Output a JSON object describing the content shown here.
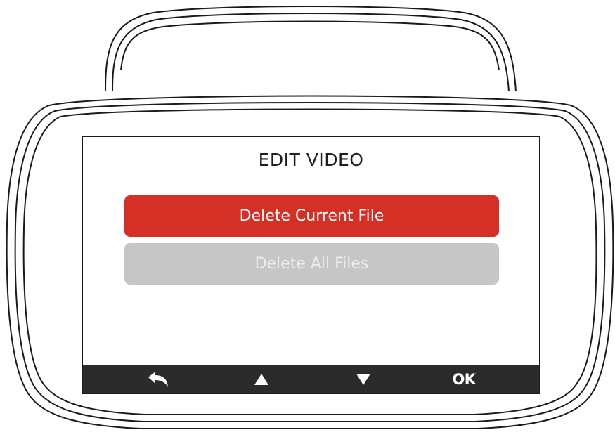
{
  "screen": {
    "title": "EDIT VIDEO",
    "menu_items": [
      {
        "label": "Delete Current File",
        "selected": true
      },
      {
        "label": "Delete All Files",
        "selected": false
      }
    ]
  },
  "controls": [
    {
      "icon": "back-arrow-icon"
    },
    {
      "icon": "up-triangle-icon"
    },
    {
      "icon": "down-triangle-icon"
    },
    {
      "label": "OK"
    }
  ],
  "colors": {
    "selected_item": "#d63026",
    "unselected_item": "#c6c6c6",
    "control_bar": "#2b2b2b"
  }
}
